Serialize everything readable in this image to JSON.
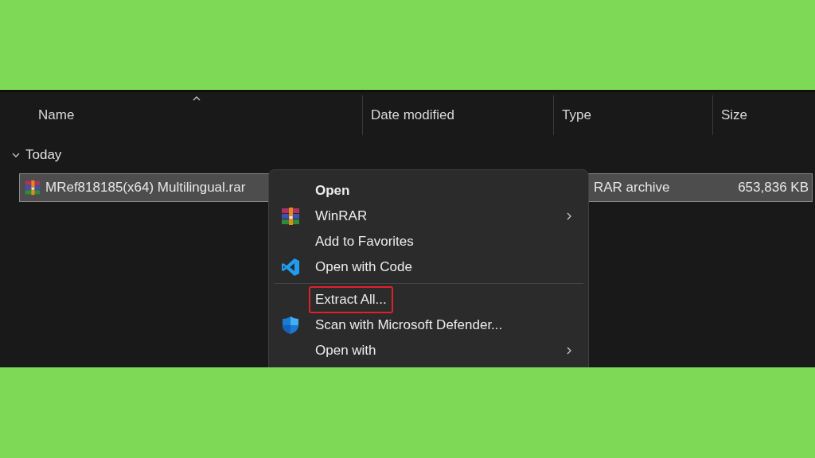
{
  "columns": [
    {
      "label": "Name",
      "sorted": true
    },
    {
      "label": "Date modified",
      "sorted": false
    },
    {
      "label": "Type",
      "sorted": false
    },
    {
      "label": "Size",
      "sorted": false
    }
  ],
  "group": {
    "label": "Today",
    "expanded": true
  },
  "file": {
    "name": "MRef818185(x64) Multilingual.rar",
    "type": "RAR archive",
    "size": "653,836 KB",
    "selected": true
  },
  "context_menu": {
    "items": [
      {
        "label": "Open",
        "kind": "default",
        "submenu": false,
        "highlighted": false
      },
      {
        "label": "WinRAR",
        "kind": "archive",
        "submenu": true,
        "highlighted": false
      },
      {
        "label": "Add to Favorites",
        "kind": "plain",
        "submenu": false,
        "highlighted": false
      },
      {
        "label": "Open with Code",
        "kind": "code",
        "submenu": false,
        "highlighted": false
      },
      {
        "kind": "separator"
      },
      {
        "label": "Extract All...",
        "kind": "plain",
        "submenu": false,
        "highlighted": true
      },
      {
        "label": "Scan with Microsoft Defender...",
        "kind": "shield",
        "submenu": false,
        "highlighted": false
      },
      {
        "label": "Open with",
        "kind": "plain",
        "submenu": true,
        "highlighted": false
      }
    ]
  }
}
